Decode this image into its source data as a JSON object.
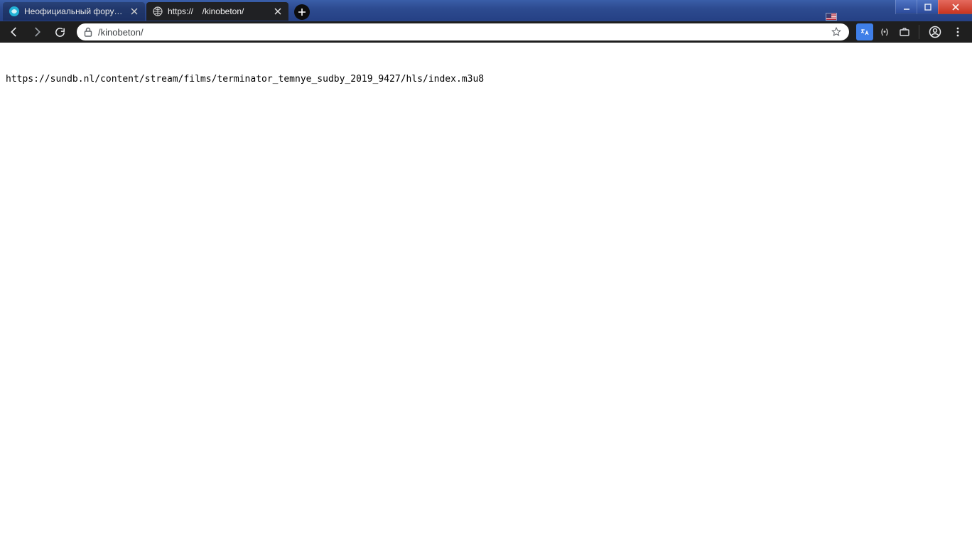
{
  "tabs": [
    {
      "title": "Неофициальный форум DLNA |",
      "active": false,
      "favicon": "round-blue"
    },
    {
      "title": "https://       /kinobeton/",
      "active": true,
      "favicon": "globe"
    }
  ],
  "addressbar": {
    "url_display": "/kinobeton/"
  },
  "page_body_text": "https://sundb.nl/content/stream/films/terminator_temnye_sudby_2019_9427/hls/index.m3u8",
  "language_indicator": "US",
  "toolbar_extensions": [
    {
      "name": "google-translate"
    },
    {
      "name": "brackets",
      "label": "(•)"
    },
    {
      "name": "work"
    }
  ]
}
